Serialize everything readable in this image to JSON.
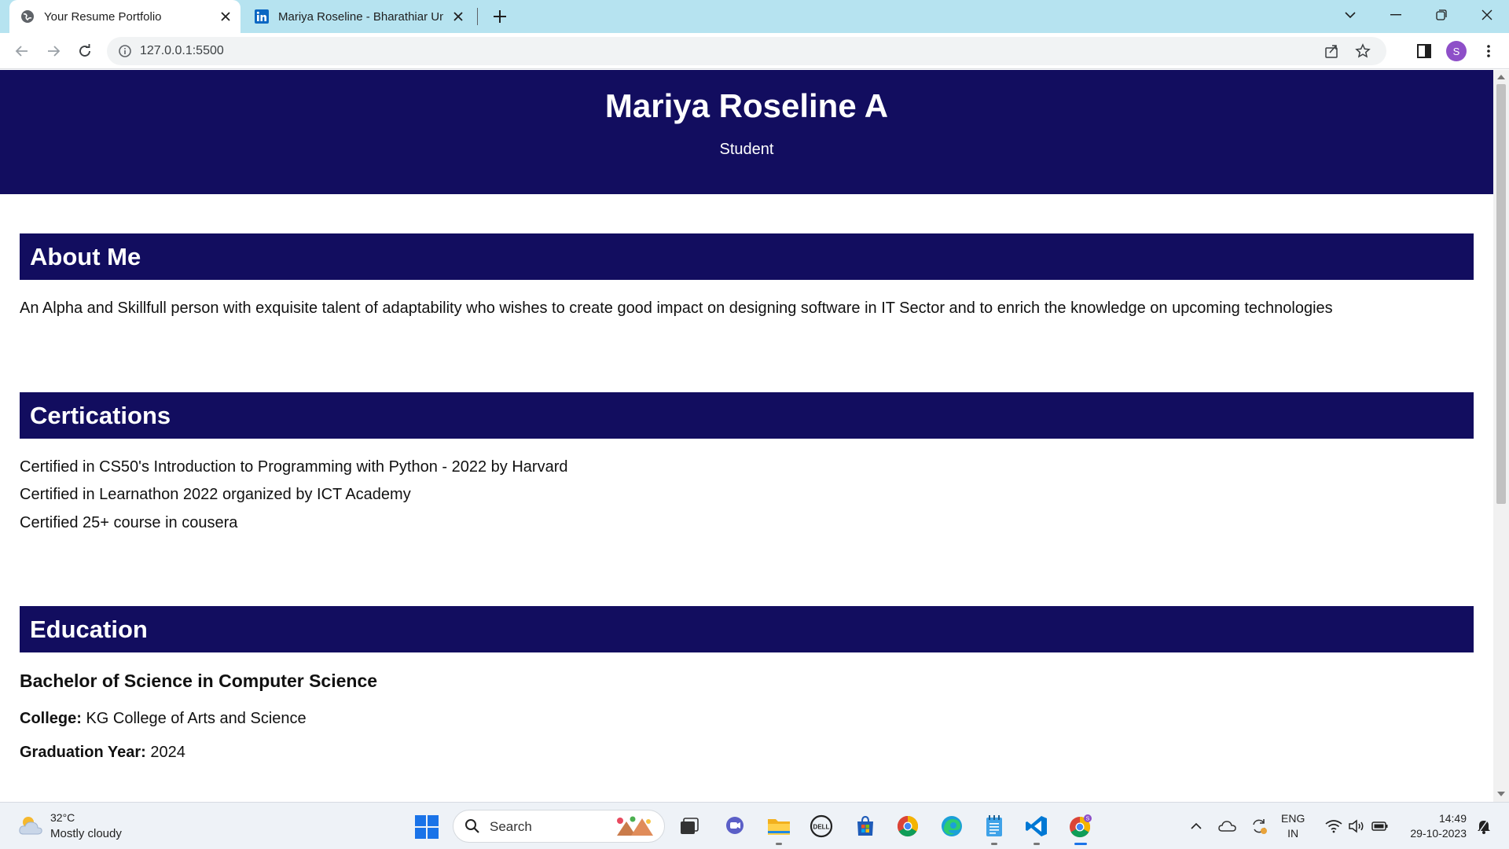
{
  "browser": {
    "tabs": [
      {
        "title": "Your Resume Portfolio",
        "active": true
      },
      {
        "title": "Mariya Roseline - Bharathiar Uni",
        "active": false
      }
    ],
    "url": "127.0.0.1:5500",
    "profile_initial": "S"
  },
  "page": {
    "header": {
      "name": "Mariya Roseline A",
      "role": "Student"
    },
    "about": {
      "heading": "About Me",
      "text": "An Alpha and Skillfull person with exquisite talent of adaptability who wishes to create good impact on designing software in IT Sector and to enrich the knowledge on upcoming technologies"
    },
    "certifications": {
      "heading": "Certications",
      "items": [
        "Certified in CS50's Introduction to Programming with Python - 2022 by Harvard",
        "Certified in Learnathon 2022 organized by ICT Academy",
        "Certified 25+ course in cousera"
      ]
    },
    "education": {
      "heading": "Education",
      "degree": "Bachelor of Science in Computer Science",
      "college_label": "College:",
      "college": "KG College of Arts and Science",
      "year_label": "Graduation Year:",
      "year": "2024"
    }
  },
  "taskbar": {
    "weather": {
      "temp": "32°C",
      "desc": "Mostly cloudy"
    },
    "search_label": "Search",
    "lang_line1": "ENG",
    "lang_line2": "IN",
    "time": "14:49",
    "date": "29-10-2023"
  },
  "colors": {
    "header_bg": "#120d5f",
    "tabbar_bg": "#b6e3f0",
    "profile": "#8e4fc8"
  }
}
